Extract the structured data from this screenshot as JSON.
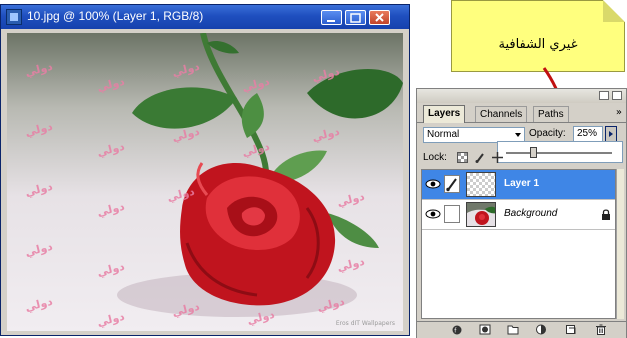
{
  "document": {
    "title": "10.jpg @ 100% (Layer 1, RGB/8)",
    "watermark_text": "دولي",
    "credit_text": "Eros dIT Wallpapers",
    "colors": {
      "title_bar": "#1f4fbf",
      "rose": "#d8222c",
      "leaf": "#2d6a2a",
      "watermark": "#e87fa5"
    }
  },
  "note": {
    "text": "غيري الشفافية",
    "color": "#ffff7e",
    "arrow_color": "#c01010"
  },
  "panel": {
    "tabs": [
      {
        "label": "Layers",
        "active": true
      },
      {
        "label": "Channels",
        "active": false
      },
      {
        "label": "Paths",
        "active": false
      }
    ],
    "menu_icon": "panel-menu-icon",
    "blend_mode": "Normal",
    "opacity_label": "Opacity:",
    "opacity_value": "25%",
    "opacity_fraction": 0.25,
    "lock_label": "Lock:",
    "layers": [
      {
        "name": "Layer 1",
        "selected": true,
        "visible": true,
        "locked": false,
        "thumbnail": "transparent"
      },
      {
        "name": "Background",
        "selected": false,
        "visible": true,
        "locked": true,
        "thumbnail": "rose"
      }
    ],
    "bottom_icons": [
      "link-icon",
      "layer-style-icon",
      "mask-icon",
      "group-icon",
      "adjustment-icon",
      "new-layer-icon",
      "trash-icon"
    ]
  }
}
